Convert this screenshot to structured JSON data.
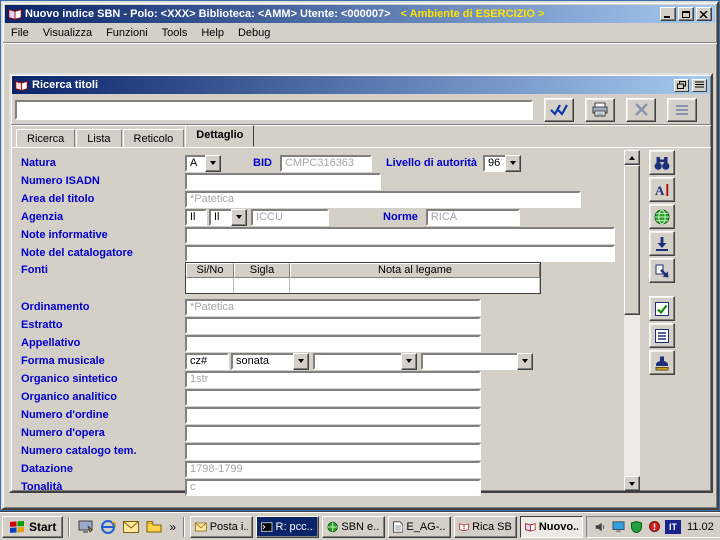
{
  "titlebar": {
    "title": "Nuovo indice SBN - Polo: <XXX> Biblioteca: <AMM> Utente: <000007>",
    "environment": "< Ambiente di ESERCIZIO >"
  },
  "menubar": {
    "items": [
      "File",
      "Visualizza",
      "Funzioni",
      "Tools",
      "Help",
      "Debug"
    ]
  },
  "child_window": {
    "title": "Ricerca titoli",
    "command_value": "",
    "tabs": [
      "Ricerca",
      "Lista",
      "Reticolo",
      "Dettaglio"
    ],
    "active_tab": "Dettaglio"
  },
  "form": {
    "natura": {
      "label": "Natura",
      "value": "A"
    },
    "bid": {
      "label": "BID",
      "value": "CMPC316363"
    },
    "livello": {
      "label": "Livello di autorità",
      "value": "96"
    },
    "numero_isadn": {
      "label": "Numero ISADN",
      "value": ""
    },
    "area_del_titolo": {
      "label": "Area del titolo",
      "value": "*Patetica"
    },
    "agenzia": {
      "label": "Agenzia",
      "value1": "Il",
      "value2": "Il",
      "value3": "ICCU"
    },
    "norme": {
      "label": "Norme",
      "value": "RICA"
    },
    "note_informative": {
      "label": "Note informative",
      "value": ""
    },
    "note_catalogatore": {
      "label": "Note del catalogatore",
      "value": ""
    },
    "fonti": {
      "label": "Fonti",
      "headers": [
        "Si/No",
        "Sigla",
        "Nota al legame"
      ]
    },
    "ordinamento": {
      "label": "Ordinamento",
      "value": "*Patetica"
    },
    "estratto": {
      "label": "Estratto",
      "value": ""
    },
    "appellativo": {
      "label": "Appellativo",
      "value": ""
    },
    "forma_musicale": {
      "label": "Forma musicale",
      "value1": "cz#",
      "value2": "sonata",
      "value3": "",
      "value4": ""
    },
    "organico_sintetico": {
      "label": "Organico sintetico",
      "value": "1str"
    },
    "organico_analitico": {
      "label": "Organico analitico",
      "value": ""
    },
    "numero_ordine": {
      "label": "Numero d'ordine",
      "value": ""
    },
    "numero_opera": {
      "label": "Numero d'opera",
      "value": ""
    },
    "numero_catalogo": {
      "label": "Numero catalogo tem.",
      "value": ""
    },
    "datazione": {
      "label": "Datazione",
      "value": "1798-1799"
    },
    "tonalita": {
      "label": "Tonalità",
      "value": "c"
    }
  },
  "taskbar": {
    "start_label": "Start",
    "tasks": [
      "Posta i...",
      "R: pcc...",
      "SBN e...",
      "E_AG-...",
      "Rica SBN",
      "Nuovo..."
    ],
    "language": "IT",
    "clock": "11.02"
  }
}
